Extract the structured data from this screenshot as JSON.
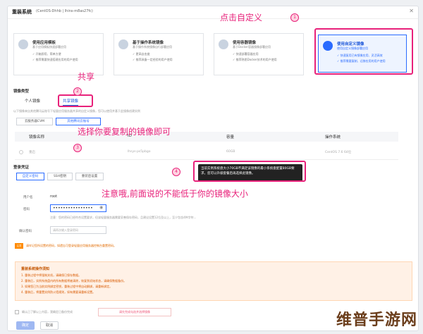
{
  "header": {
    "title": "重装系统",
    "instance": "(CentOS-Dhhb | lhins-m8as27fc)",
    "close": "✕"
  },
  "cards": [
    {
      "title": "使用应用模板",
      "desc": "基于应用模板快速部署应用",
      "b1": "✓ 开箱即用、简单方便",
      "b2": "✓ 推荐需要快速搭建应用的用户使用"
    },
    {
      "title": "基于操作系统镜像",
      "desc": "基于操作系统镜像自行部署应用",
      "b1": "✓ 更高自由度",
      "b2": "✓ 推荐具备一定经验的用户使用"
    },
    {
      "title": "使用容器镜像",
      "desc": "基于Docker容器镜像部署应用",
      "b1": "✓ 快速部署容器应用",
      "b2": "✓ 推荐熟悉Docker技术的用户使用"
    },
    {
      "title": "使用自定义镜像",
      "desc": "使用自定义镜像部署应用",
      "b1": "✓ 快速复用已有镜像应用、灵活高效",
      "b2": "✓ 推荐需要复制、迁移应用的用户使用"
    }
  ],
  "annotations": {
    "a1": "点击自定义",
    "n1": "1",
    "a2": "共享",
    "n2": "2",
    "a3": "选择你要复制的镜像即可",
    "n3": "3",
    "a4": "注意哦,前面说的不能低于你的镜像大小",
    "n4": "4"
  },
  "image_section": {
    "label": "镜像类型",
    "tab_personal": "个人镜像",
    "tab_shared": "共享镜像",
    "hint": "以下镜像来自其他腾讯云账号下轻量应用服务器共享的自定义镜像，您可以使用并基于此镜像创建实例",
    "seg_cvm": "云服务器CVM",
    "seg_shared": "其他腾讯云账号"
  },
  "table": {
    "headers": [
      "镜像名称",
      "ID",
      "容量",
      "操作系统"
    ],
    "row": [
      "重启",
      "lhsys-ps5pbgo",
      "60GB",
      "CentOS 7.6 64位"
    ]
  },
  "tooltip": "当前实例系统盘大小70GB不满足该镜像的最小系统盘配置80GB要求，您可以升级套餐后再选择此镜像。",
  "login": {
    "label": "登录凭证",
    "tab1": "自定义密码",
    "tab2": "SSH密钥",
    "tab3": "重装后设置",
    "user_label": "用户名",
    "user_value": "root",
    "pwd_label": "密码",
    "pwd_value": "••••••••••••••••",
    "pwd_hint": "注意：您的密码已经符合设置要求，但该轻量服务器需要妥善保存密码，且建议设置12位及以上，至少包含4种字符...",
    "confirm_label": "确认密码",
    "confirm_placeholder": "请再次输入登录密码"
  },
  "warning": {
    "tag": "注意",
    "text": "请牢记您所设置的密码，如遗忘可登录轻量应用服务器控制台重置密码。"
  },
  "notice": {
    "title": "重装系统操作须知",
    "lines": [
      "1. 重装过程中将强制关机，请确保已保存数据。",
      "2. 重装后，实例系统盘内的所有数据将被清除，恢复到初始状态，请确保数据备份。",
      "3. 如果您已为当前实例绑定密钥，重装过程中将自动解绑，请重新绑定。",
      "4. 重装后，将重置实例防火墙规则，如有需要请重新设置。"
    ]
  },
  "footer": {
    "agree": "确认已了解以上内容，我确定已备份完成",
    "ext": "请先完成勾选并选择镜像",
    "ok": "确定",
    "cancel": "取消"
  },
  "watermark": "维普手游网",
  "colors": {
    "accent": "#2a6bff",
    "annotation": "#e8217a",
    "warning": "#ff8a00"
  }
}
